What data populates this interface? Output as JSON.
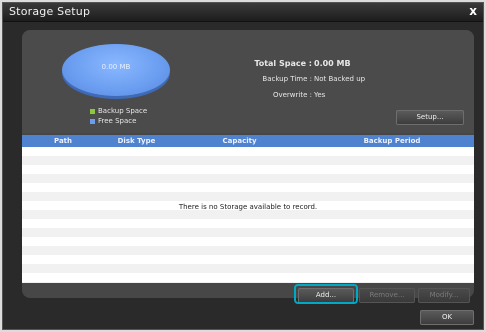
{
  "window": {
    "title": "Storage Setup",
    "close_label": "x"
  },
  "summary": {
    "pie_label": "0.00 MB",
    "legend": [
      {
        "label": "Backup Space",
        "color": "#8dc63f"
      },
      {
        "label": "Free Space",
        "color": "#6a9df0"
      }
    ],
    "total_space_label": "Total Space :",
    "total_space_value": "0.00 MB",
    "backup_time_label": "Backup Time :",
    "backup_time_value": "Not Backed up",
    "overwrite_label": "Overwrite :",
    "overwrite_value": "Yes",
    "setup_button": "Setup..."
  },
  "table": {
    "columns": [
      "Path",
      "Disk Type",
      "Capacity",
      "Backup Period"
    ],
    "empty_message": "There is no Storage available to record."
  },
  "buttons": {
    "add": "Add...",
    "remove": "Remove...",
    "modify": "Modify...",
    "ok": "OK"
  },
  "colors": {
    "accent": "#4f82cf",
    "highlight": "#00a9c6"
  }
}
